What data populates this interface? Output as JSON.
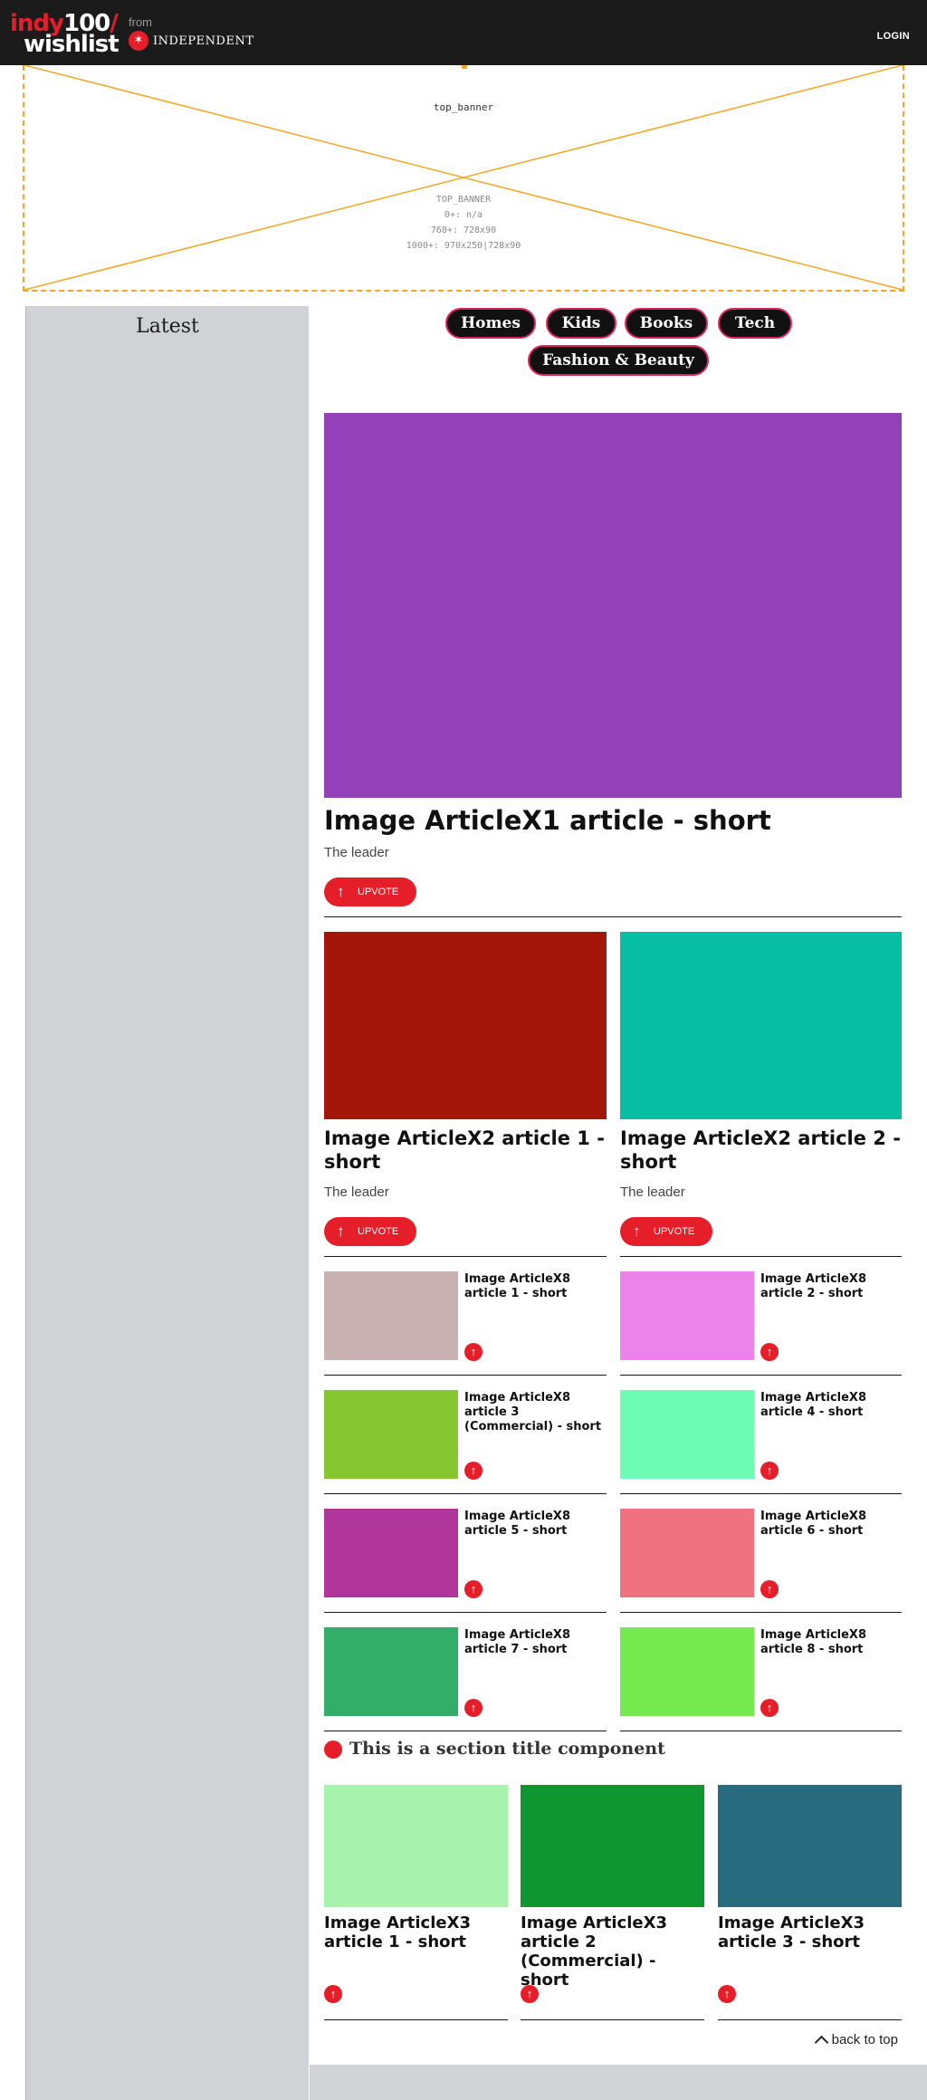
{
  "header": {
    "logo_line1_indy": "indy",
    "logo_line1_num": "100",
    "logo_line1_slash": "/",
    "logo_line2": "wishlist",
    "from_label": "from",
    "partner_name": "INDEPENDENT",
    "login_label": "LOGIN"
  },
  "banner": {
    "name": "top_banner",
    "spec_title": "TOP_BANNER",
    "spec_lines": [
      "0+: n/a",
      "768+: 728x90",
      "1000+: 970x250|728x90"
    ],
    "border_color": "#f5a623"
  },
  "sidebar": {
    "title": "Latest"
  },
  "nav": {
    "pills": [
      "Homes",
      "Kids",
      "Books",
      "Tech",
      "Fashion & Beauty"
    ]
  },
  "hero": {
    "title": "Image ArticleX1 article - short",
    "leader": "The leader",
    "upvote": "UPVOTE",
    "image_color": "#9241b7"
  },
  "x2": [
    {
      "title": "Image ArticleX2 article 1 - short",
      "leader": "The leader",
      "upvote": "UPVOTE",
      "image_color": "#a5160a"
    },
    {
      "title": "Image ArticleX2 article 2 - short",
      "leader": "The leader",
      "upvote": "UPVOTE",
      "image_color": "#07bda3"
    }
  ],
  "x8": [
    {
      "title": "Image ArticleX8 article 1 - short",
      "image_color": "#c8b2b2"
    },
    {
      "title": "Image ArticleX8 article 2 - short",
      "image_color": "#ec83ea"
    },
    {
      "title": "Image ArticleX8 article 3 (Commercial) - short",
      "image_color": "#87c631"
    },
    {
      "title": "Image ArticleX8 article 4 - short",
      "image_color": "#6efbb3"
    },
    {
      "title": "Image ArticleX8 article 5 - short",
      "image_color": "#b0369c"
    },
    {
      "title": "Image ArticleX8 article 6 - short",
      "image_color": "#f07280"
    },
    {
      "title": "Image ArticleX8 article 7 - short",
      "image_color": "#33ae69"
    },
    {
      "title": "Image ArticleX8 article 8 - short",
      "image_color": "#75e94e"
    }
  ],
  "section": {
    "title": "This is a section title component"
  },
  "x3": [
    {
      "title": "Image ArticleX3 article 1 - short",
      "image_color": "#a7f3ae"
    },
    {
      "title": "Image ArticleX3 article 2 (Commercial) - short",
      "image_color": "#0e9630"
    },
    {
      "title": "Image ArticleX3 article 3 - short",
      "image_color": "#286b7f"
    }
  ],
  "footer": {
    "back_to_top": "back to top"
  },
  "colors": {
    "accent": "#e61e2a",
    "header_bg": "#1b1b1b",
    "sidebar_bg": "#d1d2d6"
  }
}
